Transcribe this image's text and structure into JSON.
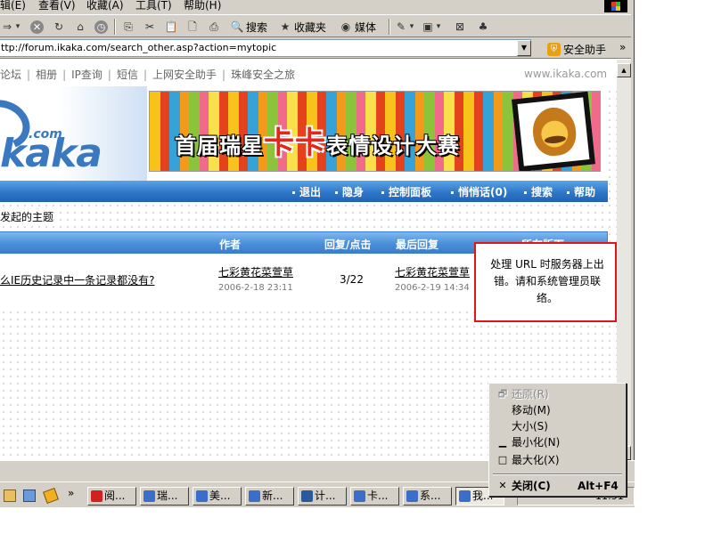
{
  "browser": {
    "menu": [
      "辑(E)",
      "查看(V)",
      "收藏(A)",
      "工具(T)",
      "帮助(H)"
    ],
    "toolbar": {
      "forward_glyph": "⇒",
      "forward_dropdown": "▾",
      "search": "搜索",
      "favorites": "收藏夹",
      "media": "媒体"
    },
    "address": {
      "value": "ttp://forum.ikaka.com/search_other.asp?action=mytopic",
      "dropdown_glyph": "▼"
    },
    "helper": {
      "label": "安全助手",
      "more_glyph": "»"
    }
  },
  "site": {
    "top_nav": [
      "论坛",
      "相册",
      "IP查询",
      "短信",
      "上网安全助手",
      "珠峰安全之旅"
    ],
    "top_nav_separator": "|",
    "domain": "www.ikaka.com",
    "logo": {
      "com": ".com",
      "word": "kaka"
    },
    "banner": {
      "prefix": "首届瑞星",
      "kaka": "卡卡",
      "suffix": "表情设计大赛"
    },
    "bluebar_links": [
      "退出",
      "隐身",
      "控制面板",
      "悄悄话(0)",
      "搜索",
      "帮助"
    ],
    "page_title": "发起的主题",
    "table": {
      "headers": {
        "author": "作者",
        "replies_views": "回复/点击",
        "last_reply": "最后回复",
        "board": "所在版面"
      },
      "rows": [
        {
          "topic": "么IE历史记录中一条记录都没有?",
          "author": "七彩黄花菜萱草",
          "posted": "2006-2-18 23:11",
          "replies_views": "3/22",
          "last_reply_author": "七彩黄花菜萱草",
          "last_reply_time": "2006-2-19 14:34"
        }
      ]
    },
    "error_message": "处理 URL 时服务器上出错。请和系统管理员联络。"
  },
  "scrollbar": {
    "up_glyph": "▲",
    "down_glyph": "▼"
  },
  "taskbar": {
    "more_glyph": "»",
    "tasks": [
      "阅...",
      "瑞...",
      "美...",
      "新...",
      "计...",
      "卡...",
      "系...",
      "我..."
    ],
    "clock": "11:51"
  },
  "context_menu": {
    "items": [
      {
        "label": "还原(R)",
        "icon": "restore-icon",
        "glyph": "🗗",
        "disabled": true
      },
      {
        "label": "移动(M)",
        "icon": "",
        "glyph": "",
        "disabled": false
      },
      {
        "label": "大小(S)",
        "icon": "",
        "glyph": "",
        "disabled": false
      },
      {
        "label": "最小化(N)",
        "icon": "minimize-icon",
        "glyph": "▁",
        "disabled": false
      },
      {
        "label": "最大化(X)",
        "icon": "maximize-icon",
        "glyph": "□",
        "disabled": false
      }
    ],
    "close": {
      "label": "关闭(C)",
      "accelerator": "Alt+F4",
      "glyph": "✕"
    }
  },
  "colors": {
    "brand_blue": "#2f77c9",
    "error_border": "#e0151b",
    "chrome_gray": "#d4d0c8"
  }
}
